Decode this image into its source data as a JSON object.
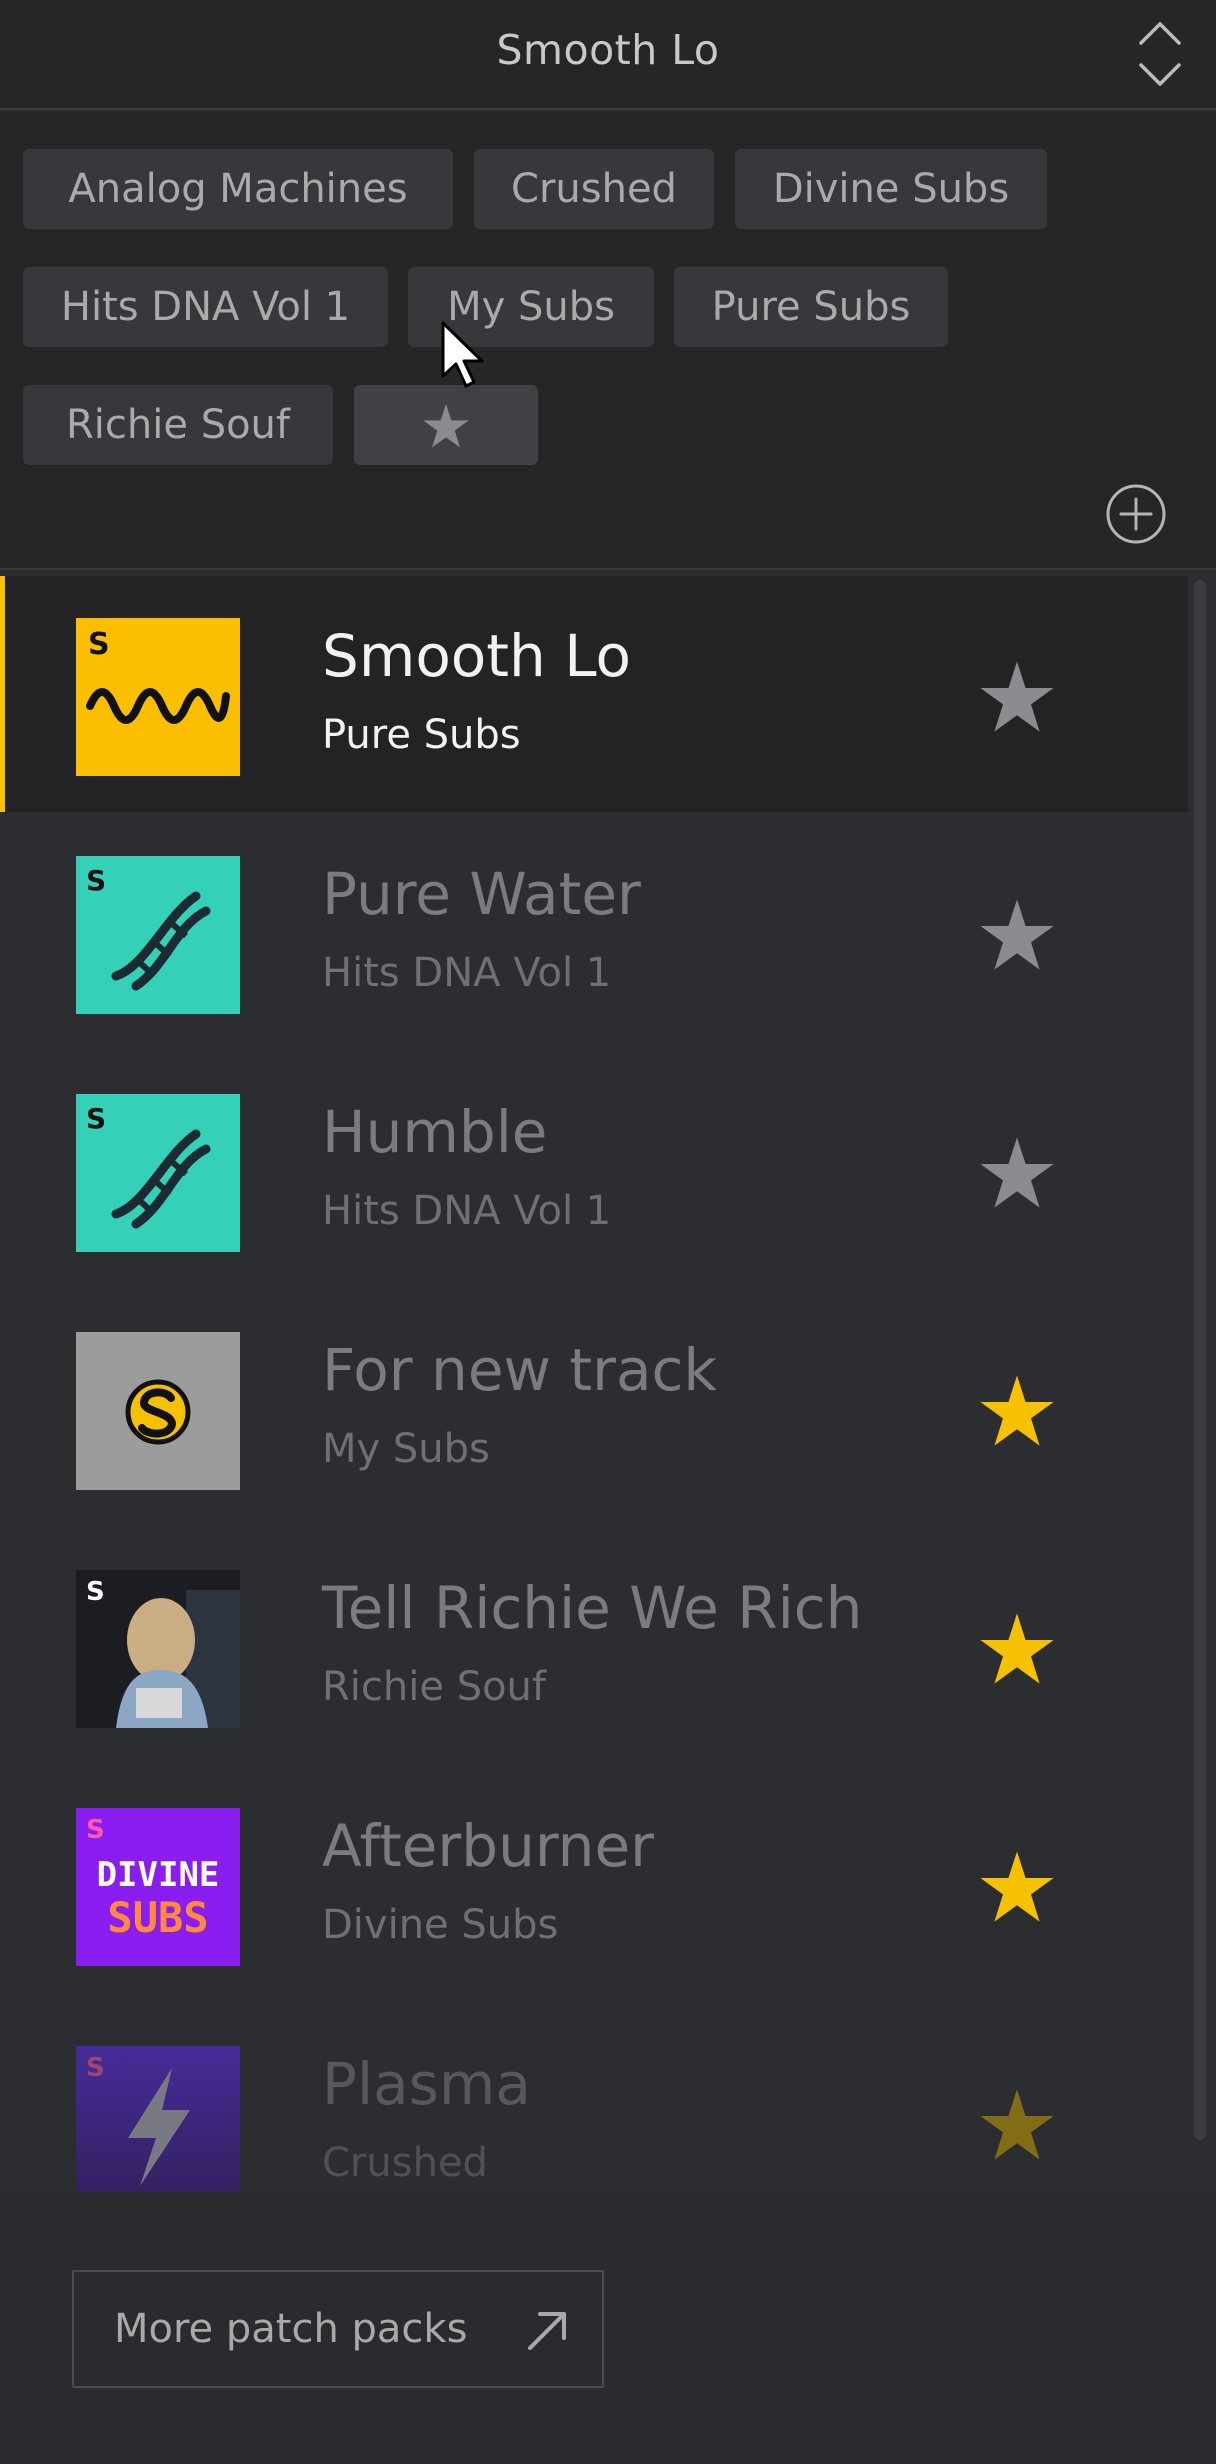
{
  "header": {
    "title": "Smooth Lo"
  },
  "filters": {
    "tags": [
      "Analog Machines",
      "Crushed",
      "Divine Subs",
      "Hits DNA Vol 1",
      "My Subs",
      "Pure Subs",
      "Richie Souf"
    ],
    "favorites_icon": "star-icon",
    "add_icon": "plus-circle-icon"
  },
  "list": {
    "items": [
      {
        "title": "Smooth Lo",
        "pack": "Pure Subs",
        "favorite": false,
        "selected": true,
        "art": "yellow-wave"
      },
      {
        "title": "Pure Water",
        "pack": "Hits DNA Vol 1",
        "favorite": false,
        "selected": false,
        "art": "teal-dna"
      },
      {
        "title": "Humble",
        "pack": "Hits DNA Vol 1",
        "favorite": false,
        "selected": false,
        "art": "teal-dna"
      },
      {
        "title": "For new track",
        "pack": "My Subs",
        "favorite": true,
        "selected": false,
        "art": "gray-logo"
      },
      {
        "title": "Tell Richie We Rich",
        "pack": "Richie Souf",
        "favorite": true,
        "selected": false,
        "art": "photo"
      },
      {
        "title": "Afterburner",
        "pack": "Divine Subs",
        "favorite": true,
        "selected": false,
        "art": "divine-subs"
      },
      {
        "title": "Plasma",
        "pack": "Crushed",
        "favorite": true,
        "selected": false,
        "art": "purple-bolt"
      }
    ],
    "art_labels": {
      "divine_line1": "DIVINE",
      "divine_line2": "SUBS"
    }
  },
  "footer": {
    "more_label": "More patch packs",
    "more_icon": "arrow-up-right-icon"
  },
  "colors": {
    "accent": "#f5c100",
    "star_on": "#f5c100",
    "star_off": "#8b8c8f",
    "teal": "#35d0b8",
    "purple": "#8a1df0"
  }
}
